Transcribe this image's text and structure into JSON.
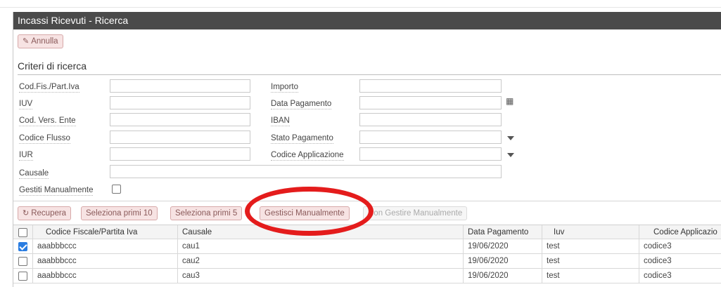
{
  "window": {
    "title": "Incassi Ricevuti - Ricerca"
  },
  "toolbar": {
    "annulla_label": "Annulla"
  },
  "section": {
    "title": "Criteri di ricerca"
  },
  "fields": {
    "cod_fis_label": "Cod.Fis./Part.Iva",
    "iuv_label": "IUV",
    "cod_vers_label": "Cod. Vers. Ente",
    "codice_flusso_label": "Codice Flusso",
    "iur_label": "IUR",
    "causale_label": "Causale",
    "gestiti_label": "Gestiti Manualmente",
    "importo_label": "Importo",
    "data_pagamento_label": "Data Pagamento",
    "iban_label": "IBAN",
    "stato_pagamento_label": "Stato Pagamento",
    "codice_applicazione_label": "Codice Applicazione"
  },
  "actions": {
    "recupera": "Recupera",
    "seleziona_10": "Seleziona primi 10",
    "seleziona_5": "Seleziona primi 5",
    "gestisci": "Gestisci Manualmente",
    "non_gestire": "Non Gestire Manualmente"
  },
  "table": {
    "columns": [
      "Codice Fiscale/Partita Iva",
      "Causale",
      "Data Pagamento",
      "Iuv",
      "Codice Applicazio"
    ],
    "rows": [
      {
        "checked": true,
        "cf": "aaabbbccc",
        "causale": "cau1",
        "data": "19/06/2020",
        "iuv": "test",
        "app": "codice3"
      },
      {
        "checked": false,
        "cf": "aaabbbccc",
        "causale": "cau2",
        "data": "19/06/2020",
        "iuv": "test",
        "app": "codice3"
      },
      {
        "checked": false,
        "cf": "aaabbbccc",
        "causale": "cau3",
        "data": "19/06/2020",
        "iuv": "test",
        "app": "codice3"
      }
    ]
  },
  "colors": {
    "title_bar": "#4a4a4a",
    "button_bg": "#f7e3e3",
    "highlight_circle": "#e41c1c",
    "checkbox_on": "#2a7de1"
  },
  "icons": {
    "annulla": "eraser-icon",
    "recupera": "refresh-icon",
    "date_picker": "calendar-icon",
    "dropdown": "caret-down-icon"
  }
}
